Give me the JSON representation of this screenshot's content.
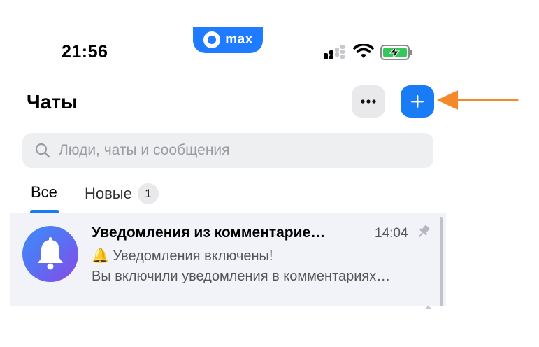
{
  "status_bar": {
    "time": "21:56",
    "app_pill_label": "max",
    "icons": [
      "signal-icon",
      "wifi-icon",
      "battery-charging-icon"
    ]
  },
  "header": {
    "title": "Чаты",
    "more_icon": "ellipsis-icon",
    "add_icon": "plus-icon"
  },
  "search": {
    "placeholder": "Люди, чаты и сообщения"
  },
  "tabs": [
    {
      "label": "Все",
      "active": true
    },
    {
      "label": "Новые",
      "badge": "1",
      "active": false
    }
  ],
  "chats": [
    {
      "title": "Уведомления из комментарие…",
      "time": "14:04",
      "preview_line1": "🔔 Уведомления включены!",
      "preview_line2": "Вы включили уведомления в комментариях…",
      "pinned": true
    }
  ],
  "colors": {
    "accent": "#1a7cf5",
    "arrow": "#f5882a",
    "chat_bg": "#f1f3f8"
  }
}
